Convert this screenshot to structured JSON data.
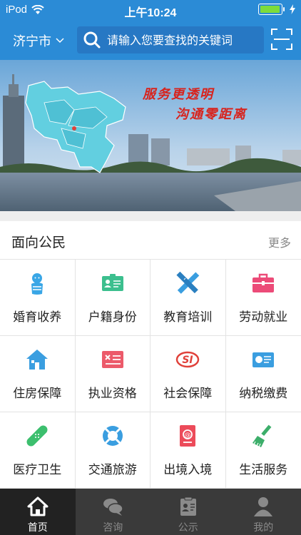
{
  "status_bar": {
    "carrier": "iPod",
    "time": "上午10:24"
  },
  "navbar": {
    "city": "济宁市",
    "search_placeholder": "请输入您要查找的关键词"
  },
  "banner": {
    "slogan_line1": "服务更透明",
    "slogan_line2": "沟通零距离"
  },
  "section": {
    "title": "面向公民",
    "more": "更多"
  },
  "services": [
    {
      "label": "婚育收养",
      "icon": "baby-icon",
      "color": "#39a6e6"
    },
    {
      "label": "户籍身份",
      "icon": "id-card-icon",
      "color": "#3cbf8e"
    },
    {
      "label": "教育培训",
      "icon": "pencil-ruler-icon",
      "color": "#3a9ee0"
    },
    {
      "label": "劳动就业",
      "icon": "briefcase-icon",
      "color": "#ec4b78"
    },
    {
      "label": "住房保障",
      "icon": "house-icon",
      "color": "#3a9ee0"
    },
    {
      "label": "执业资格",
      "icon": "certificate-icon",
      "color": "#ec5a6a"
    },
    {
      "label": "社会保障",
      "icon": "social-security-icon",
      "color": "#e0413a"
    },
    {
      "label": "纳税缴费",
      "icon": "tax-card-icon",
      "color": "#3a9ee0"
    },
    {
      "label": "医疗卫生",
      "icon": "bandage-icon",
      "color": "#3cbf6e"
    },
    {
      "label": "交通旅游",
      "icon": "lifebuoy-icon",
      "color": "#3a9ee0"
    },
    {
      "label": "出境入境",
      "icon": "passport-icon",
      "color": "#ec4b5a"
    },
    {
      "label": "生活服务",
      "icon": "broom-icon",
      "color": "#3cae6a"
    }
  ],
  "tabbar": [
    {
      "label": "首页",
      "icon": "home-icon"
    },
    {
      "label": "咨询",
      "icon": "chat-icon"
    },
    {
      "label": "公示",
      "icon": "notice-board-icon"
    },
    {
      "label": "我的",
      "icon": "user-icon"
    }
  ]
}
